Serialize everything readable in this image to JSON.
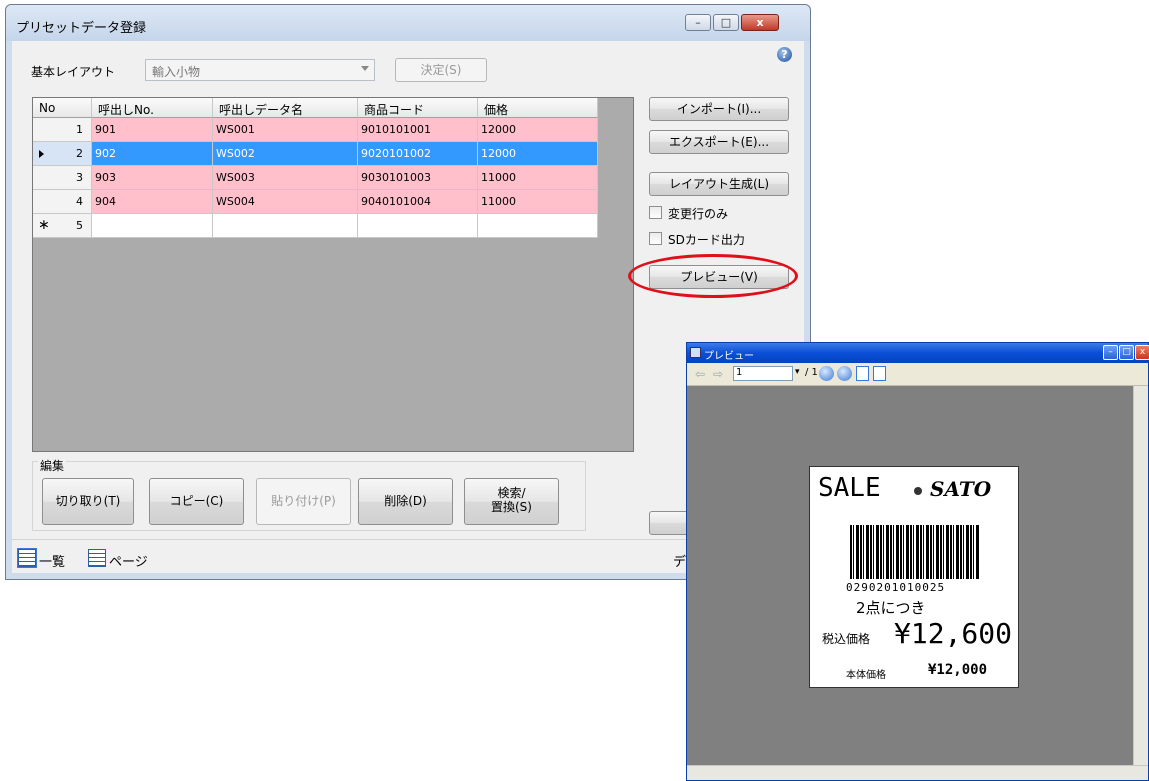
{
  "window": {
    "title": "プリセットデータ登録",
    "help_icon": "?",
    "minimize_glyph": "–",
    "maximize_glyph": "□",
    "close_glyph": "x"
  },
  "layout": {
    "label": "基本レイアウト",
    "value": "輸入小物",
    "decide_button": "決定(S)"
  },
  "grid": {
    "columns": [
      "No",
      "呼出しNo.",
      "呼出しデータ名",
      "商品コード",
      "価格"
    ],
    "rows": [
      {
        "no": "1",
        "call_no": "901",
        "name": "WS001",
        "code": "9010101001",
        "price": "12000"
      },
      {
        "no": "2",
        "call_no": "902",
        "name": "WS002",
        "code": "9020101002",
        "price": "12000"
      },
      {
        "no": "3",
        "call_no": "903",
        "name": "WS003",
        "code": "9030101003",
        "price": "11000"
      },
      {
        "no": "4",
        "call_no": "904",
        "name": "WS004",
        "code": "9040101004",
        "price": "11000"
      }
    ],
    "new_row_marker": "∗",
    "new_row_no": "5"
  },
  "side": {
    "import_button": "インポート(I)...",
    "export_button": "エクスポート(E)...",
    "layout_gen_button": "レイアウト生成(L)",
    "changed_only_label": "変更行のみ",
    "sd_output_label": "SDカード出力",
    "preview_button": "プレビュー(V)"
  },
  "edit": {
    "group_label": "編集",
    "cut_button": "切り取り(T)",
    "copy_button": "コピー(C)",
    "paste_button": "貼り付け(P)",
    "delete_button": "削除(D)",
    "search_button_line1": "検索/",
    "search_button_line2": "置換(S)"
  },
  "status": {
    "list_tab": "一覧",
    "page_tab": "ページ",
    "right_text": "デ"
  },
  "preview": {
    "title": "プレビュー",
    "page_value": "1",
    "page_total": "/ 1",
    "label": {
      "sale": "SALE",
      "brand": "SATO",
      "barcode_digits": "0290201010025",
      "quantity_text": "2点につき",
      "tax_incl_label": "税込価格",
      "tax_incl_price": "¥12,600",
      "base_label": "本体価格",
      "base_price": "¥12,000"
    }
  },
  "colors": {
    "row_pink": "#ffc0cb",
    "row_selected": "#3399ff",
    "highlight_ellipse": "#e0101a",
    "preview_title": "#0a4fd6"
  }
}
